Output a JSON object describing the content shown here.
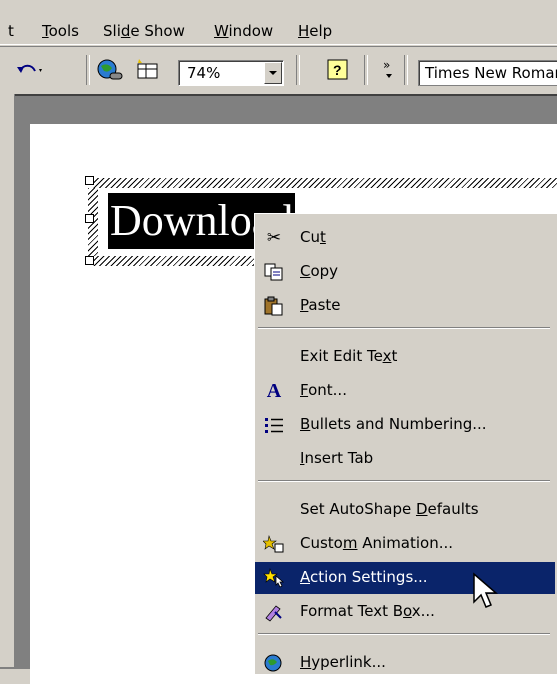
{
  "menubar": {
    "items": [
      {
        "text": "t"
      },
      {
        "pre": "",
        "acc": "T",
        "post": "ools"
      },
      {
        "pre": "Sli",
        "acc": "d",
        "post": "e Show"
      },
      {
        "pre": "",
        "acc": "W",
        "post": "indow"
      },
      {
        "pre": "",
        "acc": "H",
        "post": "elp"
      }
    ]
  },
  "toolbar": {
    "zoom_value": "74%",
    "font_name": "Times New Roman"
  },
  "slide": {
    "selected_text": "Download"
  },
  "context_menu": {
    "items": [
      {
        "pre": "Cu",
        "acc": "t",
        "post": "",
        "icon": "scissors-icon",
        "glyph": "✂"
      },
      {
        "pre": "",
        "acc": "C",
        "post": "opy",
        "icon": "copy-icon",
        "glyph": "⧉"
      },
      {
        "pre": "",
        "acc": "P",
        "post": "aste",
        "icon": "paste-icon",
        "glyph": "📋"
      },
      {
        "pre": "Exit Edit Te",
        "acc": "x",
        "post": "t",
        "icon": "",
        "glyph": ""
      },
      {
        "pre": "",
        "acc": "F",
        "post": "ont...",
        "icon": "font-icon",
        "glyph": "A"
      },
      {
        "pre": "",
        "acc": "B",
        "post": "ullets and Numbering...",
        "icon": "bullets-icon",
        "glyph": "☰"
      },
      {
        "pre": "",
        "acc": "I",
        "post": "nsert Tab",
        "icon": "",
        "glyph": ""
      },
      {
        "pre": "Set AutoShape ",
        "acc": "D",
        "post": "efaults",
        "icon": "",
        "glyph": ""
      },
      {
        "pre": "Custo",
        "acc": "m",
        "post": " Animation...",
        "icon": "custom-animation-icon",
        "glyph": "✶"
      },
      {
        "pre": "",
        "acc": "A",
        "post": "ction Settings...",
        "icon": "action-settings-icon",
        "glyph": "★"
      },
      {
        "pre": "Format Text B",
        "acc": "o",
        "post": "x...",
        "icon": "format-text-box-icon",
        "glyph": "✎"
      },
      {
        "pre": "",
        "acc": "H",
        "post": "yperlink...",
        "icon": "hyperlink-icon",
        "glyph": "🌐"
      }
    ]
  },
  "colors": {
    "menu_face": "#d4d0c8",
    "highlight": "#0a246a",
    "workspace": "#808080"
  }
}
